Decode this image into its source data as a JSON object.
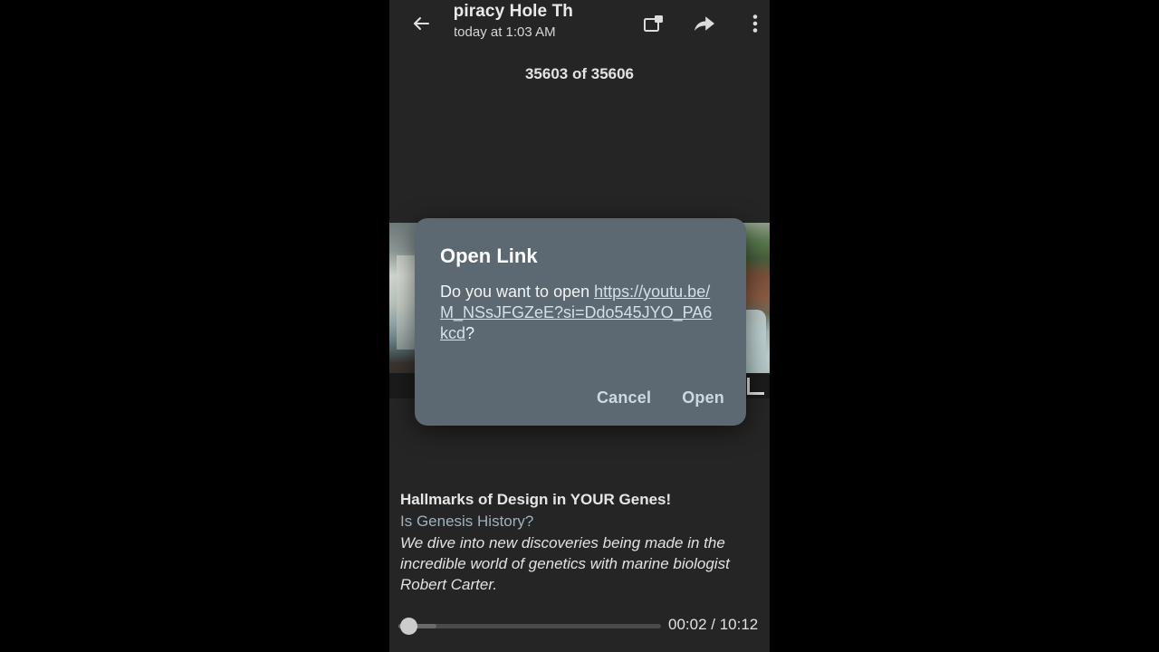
{
  "appbar": {
    "back_icon": "back-arrow-icon",
    "chat_title": "spiracy Hole   Th",
    "chat_subtitle": "today at 1:03 AM",
    "pip_icon": "picture-in-picture-icon",
    "share_icon": "share-arrow-icon",
    "more_icon": "overflow-menu-icon"
  },
  "message_counter": "35603 of 35606",
  "dialog": {
    "title": "Open Link",
    "prompt_prefix": "Do you want to open ",
    "link_text": "https://youtu.be/M_NSsJFGZeE?si=Ddo545JYO_PA6kcd",
    "prompt_suffix": "?",
    "cancel_label": "Cancel",
    "open_label": "Open",
    "background_color": "#5c6872",
    "link_color": "#d3e0e8",
    "button_color": "#ccd9e3"
  },
  "description": {
    "video_title": "Hallmarks of Design in YOUR Genes!",
    "channel_name": "Is Genesis History?",
    "channel_color": "#9fb2bb",
    "video_description": "We dive into new discoveries being made in the incredible world of genetics with marine biologist Robert Carter."
  },
  "player": {
    "current_time": "00:02",
    "total_time": "10:12",
    "time_display": "00:02 / 10:12",
    "progress_percent": 0,
    "fullscreen_icon": "fullscreen-corner-icon"
  }
}
